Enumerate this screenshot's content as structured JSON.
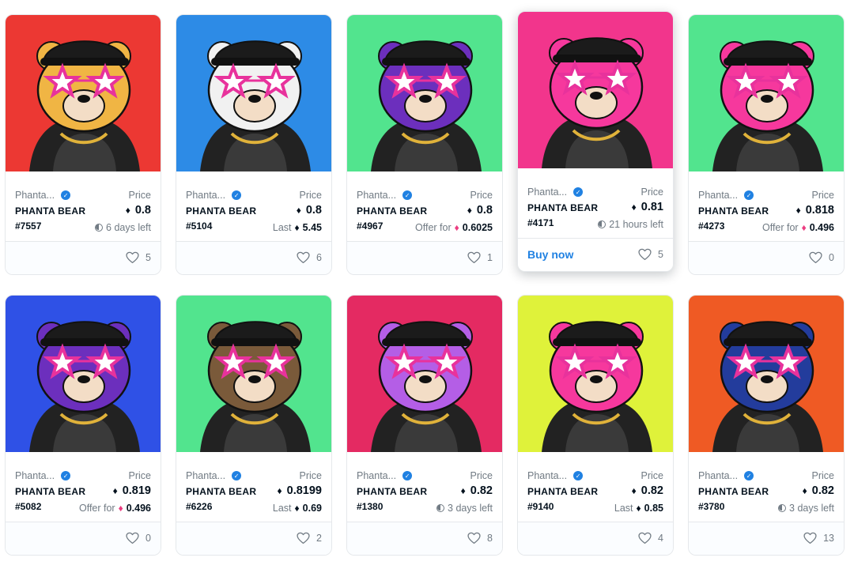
{
  "colors": {
    "verified": "#2081e2",
    "muted": "#707a83",
    "text": "#04111d",
    "weth": "#ec3d81",
    "buy_now": "#2081e2"
  },
  "cards": [
    {
      "bg": "#ec3833",
      "fur": "#f0b544",
      "collection": "Phanta...",
      "name": "PHANTA BEAR",
      "id": "#7557",
      "price_label": "Price",
      "price": "0.8",
      "sub_type": "time",
      "sub_text": "6 days left",
      "likes": "5",
      "hovered": false
    },
    {
      "bg": "#2d8be6",
      "fur": "#f1f1f1",
      "collection": "Phanta...",
      "name": "PHANTA BEAR",
      "id": "#5104",
      "price_label": "Price",
      "price": "0.8",
      "sub_type": "last",
      "sub_label": "Last",
      "sub_value": "5.45",
      "likes": "6",
      "hovered": false
    },
    {
      "bg": "#52e48e",
      "fur": "#6c2fbd",
      "collection": "Phanta...",
      "name": "PHANTA BEAR",
      "id": "#4967",
      "price_label": "Price",
      "price": "0.8",
      "sub_type": "offer",
      "sub_label": "Offer for",
      "sub_value": "0.6025",
      "likes": "1",
      "hovered": false
    },
    {
      "bg": "#f2358c",
      "fur": "#f6389d",
      "collection": "Phanta...",
      "name": "PHANTA BEAR",
      "id": "#4171",
      "price_label": "Price",
      "price": "0.81",
      "sub_type": "time",
      "sub_text": "21 hours left",
      "likes": "5",
      "hovered": true,
      "buy_now": "Buy now"
    },
    {
      "bg": "#52e48e",
      "fur": "#f6389d",
      "collection": "Phanta...",
      "name": "PHANTA BEAR",
      "id": "#4273",
      "price_label": "Price",
      "price": "0.818",
      "sub_type": "offer",
      "sub_label": "Offer for",
      "sub_value": "0.496",
      "likes": "0",
      "hovered": false
    },
    {
      "bg": "#2f51e6",
      "fur": "#6c2fbd",
      "collection": "Phanta...",
      "name": "PHANTA BEAR",
      "id": "#5082",
      "price_label": "Price",
      "price": "0.819",
      "sub_type": "offer",
      "sub_label": "Offer for",
      "sub_value": "0.496",
      "likes": "0",
      "hovered": false
    },
    {
      "bg": "#52e48e",
      "fur": "#7a5a3a",
      "collection": "Phanta...",
      "name": "PHANTA BEAR",
      "id": "#6226",
      "price_label": "Price",
      "price": "0.8199",
      "sub_type": "last",
      "sub_label": "Last",
      "sub_value": "0.69",
      "likes": "2",
      "hovered": false
    },
    {
      "bg": "#e42a62",
      "fur": "#b45ee6",
      "collection": "Phanta...",
      "name": "PHANTA BEAR",
      "id": "#1380",
      "price_label": "Price",
      "price": "0.82",
      "sub_type": "time",
      "sub_text": "3 days left",
      "likes": "8",
      "hovered": false
    },
    {
      "bg": "#dff23a",
      "fur": "#f6389d",
      "collection": "Phanta...",
      "name": "PHANTA BEAR",
      "id": "#9140",
      "price_label": "Price",
      "price": "0.82",
      "sub_type": "last",
      "sub_label": "Last",
      "sub_value": "0.85",
      "likes": "4",
      "hovered": false
    },
    {
      "bg": "#ef5a24",
      "fur": "#233c9c",
      "collection": "Phanta...",
      "name": "PHANTA BEAR",
      "id": "#3780",
      "price_label": "Price",
      "price": "0.82",
      "sub_type": "time",
      "sub_text": "3 days left",
      "likes": "13",
      "hovered": false
    }
  ]
}
